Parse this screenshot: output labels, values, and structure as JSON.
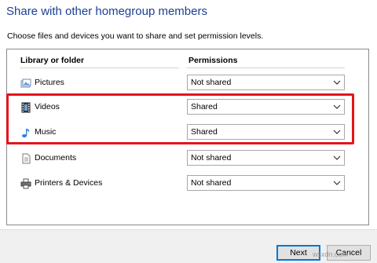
{
  "dialog": {
    "title": "Share with other homegroup members",
    "instructions": "Choose files and devices you want to share and set permission levels."
  },
  "table": {
    "headers": {
      "library": "Library or folder",
      "permissions": "Permissions"
    },
    "rows": [
      {
        "label": "Pictures",
        "icon": "pictures-icon",
        "permission": "Not shared"
      },
      {
        "label": "Videos",
        "icon": "videos-icon",
        "permission": "Shared"
      },
      {
        "label": "Music",
        "icon": "music-icon",
        "permission": "Shared"
      },
      {
        "label": "Documents",
        "icon": "documents-icon",
        "permission": "Not shared"
      },
      {
        "label": "Printers & Devices",
        "icon": "printer-icon",
        "permission": "Not shared"
      }
    ]
  },
  "annotation": {
    "highlight_color": "#e3141e"
  },
  "buttons": {
    "next": "Next",
    "cancel": "Cancel"
  },
  "watermark": "wsxdn.com",
  "colors": {
    "title": "#1c3f94",
    "accent": "#0078d7"
  }
}
